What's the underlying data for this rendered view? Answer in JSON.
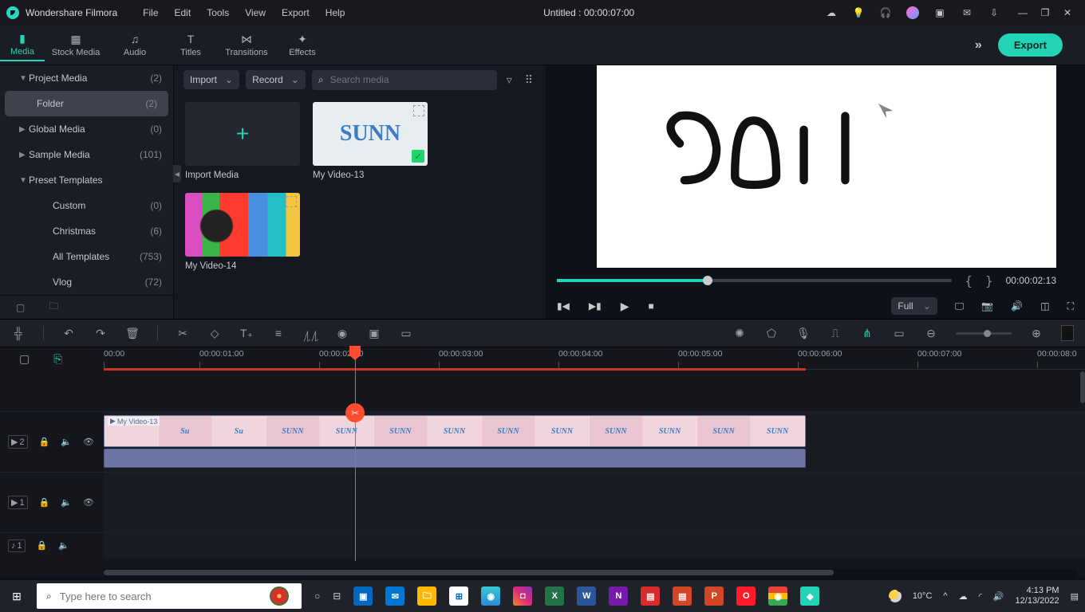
{
  "app_name": "Wondershare Filmora",
  "menus": [
    "File",
    "Edit",
    "Tools",
    "View",
    "Export",
    "Help"
  ],
  "title_center": "Untitled : 00:00:07:00",
  "tabs": {
    "media": "Media",
    "stock": "Stock Media",
    "audio": "Audio",
    "titles": "Titles",
    "transitions": "Transitions",
    "effects": "Effects"
  },
  "export_label": "Export",
  "library": {
    "tree": {
      "project_media": {
        "label": "Project Media",
        "count": "(2)"
      },
      "folder": {
        "label": "Folder",
        "count": "(2)"
      },
      "global_media": {
        "label": "Global Media",
        "count": "(0)"
      },
      "sample_media": {
        "label": "Sample Media",
        "count": "(101)"
      },
      "preset_templates": {
        "label": "Preset Templates",
        "count": ""
      },
      "custom": {
        "label": "Custom",
        "count": "(0)"
      },
      "christmas": {
        "label": "Christmas",
        "count": "(6)"
      },
      "all_templates": {
        "label": "All Templates",
        "count": "(753)"
      },
      "vlog": {
        "label": "Vlog",
        "count": "(72)"
      }
    },
    "import_btn": "Import",
    "record_btn": "Record",
    "search_placeholder": "Search media",
    "thumbs": {
      "import_media": "Import Media",
      "video13": "My Video-13",
      "video14": "My Video-14"
    }
  },
  "preview": {
    "time": "00:00:02:13",
    "quality": "Full"
  },
  "ruler_marks": [
    "00:00",
    "00:00:01:00",
    "00:00:02:00",
    "00:00:03:00",
    "00:00:04:00",
    "00:00:05:00",
    "00:00:06:00",
    "00:00:07:00",
    "00:00:08:0"
  ],
  "clip_label": "My Video-13",
  "tracks": {
    "video2": "2",
    "video1": "1",
    "audio1": "1"
  },
  "clip_word": "SUNN",
  "taskbar": {
    "search_placeholder": "Type here to search",
    "weather": "10°C",
    "time": "4:13 PM",
    "date": "12/13/2022"
  }
}
